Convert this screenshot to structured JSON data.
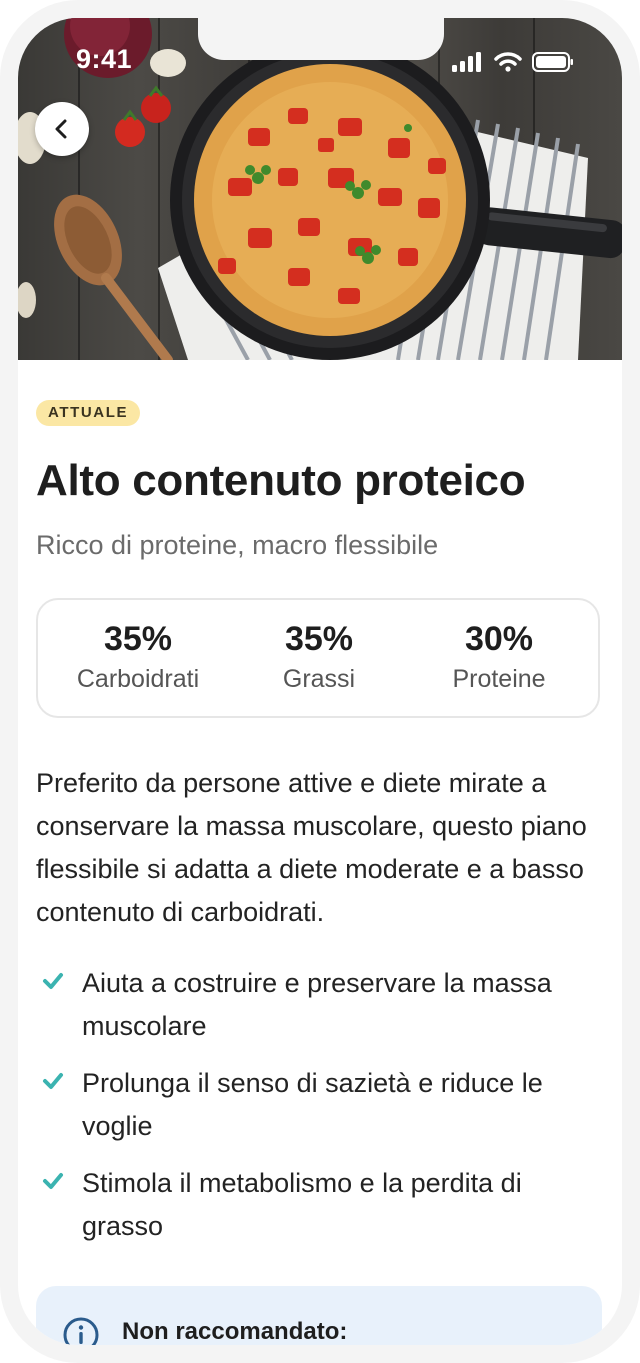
{
  "status_bar": {
    "time": "9:41"
  },
  "hero": {
    "image_icon": "frittata-pan-photo",
    "back_icon": "chevron-left-icon"
  },
  "plan": {
    "badge": "ATTUALE",
    "title": "Alto contenuto proteico",
    "subtitle": "Ricco di proteine, macro flessibile"
  },
  "macros": [
    {
      "value": "35%",
      "label": "Carboidrati"
    },
    {
      "value": "35%",
      "label": "Grassi"
    },
    {
      "value": "30%",
      "label": "Proteine"
    }
  ],
  "description": "Preferito da persone attive e diete mirate a conservare la massa muscolare, questo piano flessibile si adatta a diete moderate e a basso contenuto di carboidrati.",
  "benefits": [
    "Aiuta a costruire e preservare la massa muscolare",
    "Prolunga il senso di sazietà e riduce le voglie",
    "Stimola il metabolismo e la perdita di grasso"
  ],
  "notice": {
    "title": "Non raccomandato:"
  },
  "colors": {
    "badge_bg": "#fbe7a4",
    "check": "#3bb3b0",
    "notice_bg": "#e8f1fb",
    "info_icon": "#2a5b8c"
  }
}
